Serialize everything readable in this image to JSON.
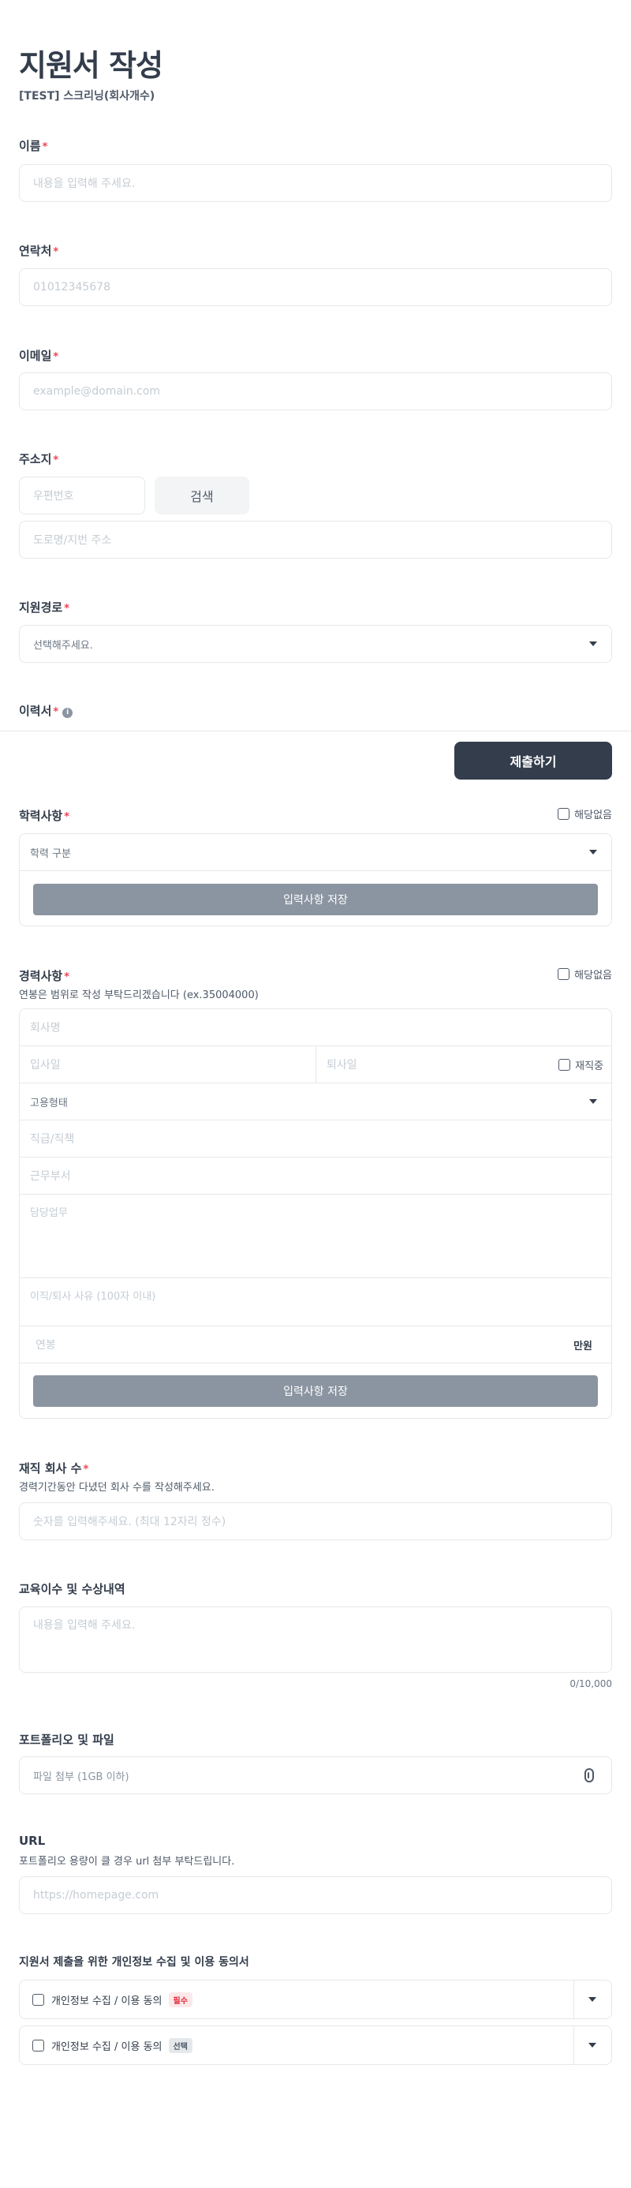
{
  "header": {
    "title": "지원서 작성",
    "subtitle": "[TEST] 스크리닝(회사개수)"
  },
  "required_mark": "*",
  "name": {
    "label": "이름",
    "placeholder": "내용을 입력해 주세요."
  },
  "phone": {
    "label": "연락처",
    "placeholder": "01012345678"
  },
  "email": {
    "label": "이메일",
    "placeholder": "example@domain.com"
  },
  "address": {
    "label": "주소지",
    "zip_placeholder": "우편번호",
    "search_label": "검색",
    "road_placeholder": "도로명/지번 주소"
  },
  "route": {
    "label": "지원경로",
    "selected": "선택해주세요."
  },
  "resume": {
    "label": "이력서",
    "info_icon": "i"
  },
  "submit_label": "제출하기",
  "education": {
    "label": "학력사항",
    "none_label": "해당없음",
    "type_placeholder": "학력 구분",
    "save_label": "입력사항 저장"
  },
  "career": {
    "label": "경력사항",
    "none_label": "해당없음",
    "help": "연봉은 범위로 작성 부탁드리겠습니다 (ex.35004000)",
    "company_placeholder": "회사명",
    "join_placeholder": "입사일",
    "leave_placeholder": "퇴사일",
    "employed_label": "재직중",
    "employment_type": "고용형태",
    "position_placeholder": "직급/직책",
    "dept_placeholder": "근무부서",
    "duty_placeholder": "담당업무",
    "reason_placeholder": "이직/퇴사 사유 (100자 이내)",
    "salary_placeholder": "연봉",
    "salary_unit": "만원",
    "save_label": "입력사항 저장"
  },
  "company_count": {
    "label": "재직 회사 수",
    "help": "경력기간동안 다녔던 회사 수를 작성해주세요.",
    "placeholder": "숫자를 입력해주세요. (최대 12자리 정수)"
  },
  "training": {
    "label": "교육이수 및 수상내역",
    "placeholder": "내용을 입력해 주세요.",
    "counter": "0/10,000"
  },
  "portfolio": {
    "label": "포트폴리오 및 파일",
    "placeholder": "파일 첨부 (1GB 이하)",
    "icon": "paperclip-icon"
  },
  "url": {
    "label": "URL",
    "help": "포트폴리오 용량이 클 경우 url 첨부 부탁드립니다.",
    "placeholder": "https://homepage.com"
  },
  "consent": {
    "title": "지원서 제출을 위한 개인정보 수집 및 이용 동의서",
    "items": [
      {
        "label": "개인정보 수집 / 이용 동의",
        "tag": "필수"
      },
      {
        "label": "개인정보 수집 / 이용 동의",
        "tag": "선택"
      }
    ]
  },
  "colors": {
    "primary": "#333d4b",
    "required": "#f04452",
    "save_button": "#8b95a1",
    "border": "#e5e8eb"
  }
}
